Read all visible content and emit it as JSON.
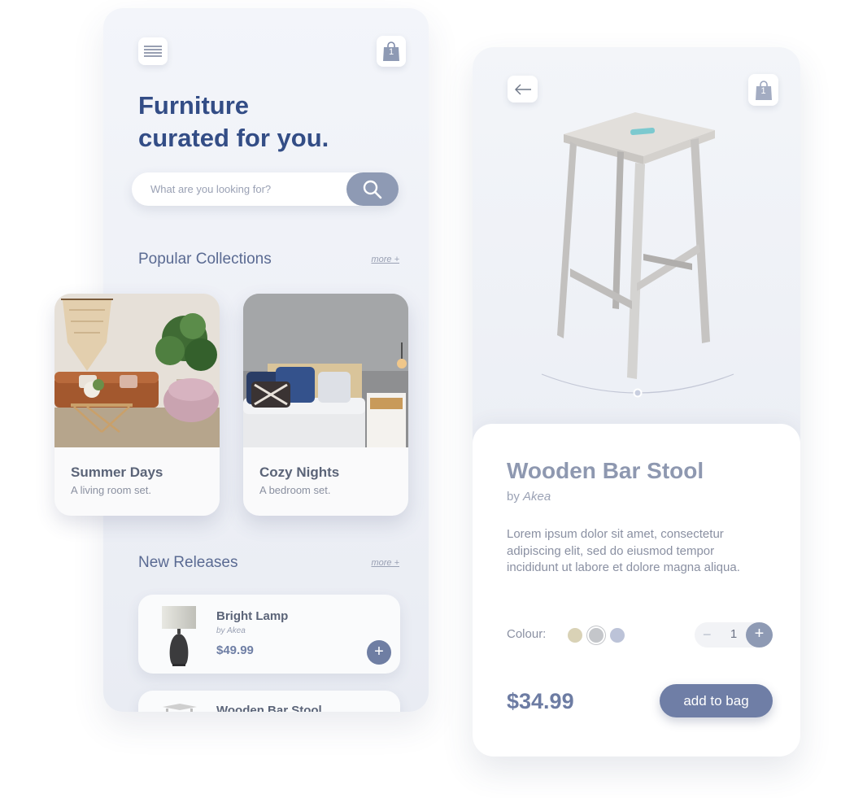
{
  "home": {
    "title_line1": "Furniture",
    "title_line2": "curated for you.",
    "bag_count": "1",
    "search": {
      "placeholder": "What are you looking for?"
    },
    "popular": {
      "title": "Popular Collections",
      "more": "more +",
      "collections": [
        {
          "name": "Summer Days",
          "subtitle": "A living room set."
        },
        {
          "name": "Cozy Nights",
          "subtitle": "A bedroom set."
        }
      ]
    },
    "releases": {
      "title": "New Releases",
      "more": "more +",
      "items": [
        {
          "name": "Bright Lamp",
          "by": "by Akea",
          "price": "$49.99",
          "add": "+"
        },
        {
          "name": "Wooden Bar Stool"
        }
      ]
    }
  },
  "product": {
    "bag_count": "1",
    "title": "Wooden Bar Stool",
    "by_prefix": "by",
    "brand": "Akea",
    "description": "Lorem ipsum dolor sit amet, consectetur adipiscing elit, sed do eiusmod tempor incididunt ut labore et dolore magna aliqua.",
    "colour_label": "Colour:",
    "colours": [
      "#d9d2b6",
      "#c4c6ca",
      "#bcc3d8"
    ],
    "quantity": {
      "minus": "−",
      "value": "1",
      "plus": "+"
    },
    "price": "$34.99",
    "add_to_bag": "add to bag"
  },
  "colors": {
    "primary": "#334d86",
    "accent": "#6f7ea6",
    "muted": "#8e9ab4"
  }
}
